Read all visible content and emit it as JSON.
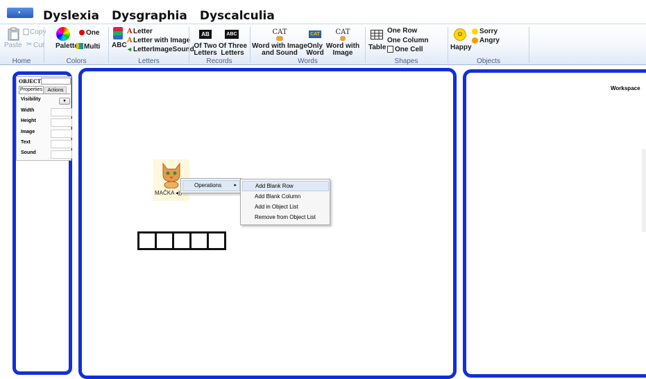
{
  "window": {
    "menu_arrow": "▾"
  },
  "tabs": [
    "Dyslexia",
    "Dysgraphia",
    "Dyscalculia"
  ],
  "ribbon": {
    "home": {
      "label": "Home",
      "paste": "Paste",
      "copy": "Copy",
      "cut": "Cut"
    },
    "colors": {
      "label": "Colors",
      "palette": "Palette",
      "one": "One",
      "multi": "Multi"
    },
    "letters": {
      "label": "Letters",
      "abc": "ABC",
      "letter": "Letter",
      "letter_with_image": "Letter with Image",
      "letter_image_sound": "LetterImageSound"
    },
    "records": {
      "label": "Records",
      "two_line1": "Of Two",
      "two_line2": "Letters",
      "three_line1": "Of Three",
      "three_line2": "Letters",
      "icon_two": "AB",
      "icon_three": "ABC"
    },
    "words": {
      "label": "Words",
      "cat": "CAT",
      "wis_line1": "Word with Image",
      "wis_line2": "and Sound",
      "only_line1": "Only",
      "only_line2": "Word",
      "wwi_line1": "Word with",
      "wwi_line2": "Image",
      "icon_only": "CAT"
    },
    "shapes": {
      "label": "Shapes",
      "table": "Table",
      "one_row": "One Row",
      "one_column": "One Column",
      "one_cell": "One Cell"
    },
    "objects": {
      "label": "Objects",
      "happy": "Happy",
      "sorry": "Sorry",
      "angry": "Angry"
    }
  },
  "properties": {
    "object_label": "OBJECT:",
    "tab_properties": "Properties",
    "tab_actions": "Actions",
    "rows": [
      "Visibility",
      "Width",
      "Height",
      "Image",
      "Text",
      "Sound"
    ],
    "dropdown_arrow": "▾"
  },
  "canvas": {
    "cat_label": "MAČKA",
    "sound_glyph": "◂))",
    "letter_box_count": 5
  },
  "context_menu": {
    "operations": "Operations",
    "arrow": "▸",
    "submenu": [
      "Add Blank Row",
      "Add Blank Column",
      "Add in Object List",
      "Remove from Object List"
    ]
  },
  "workspace": {
    "title": "Workspace"
  },
  "colors": {
    "panel_border": "#1230d8",
    "accent": "#2a5cb8"
  }
}
